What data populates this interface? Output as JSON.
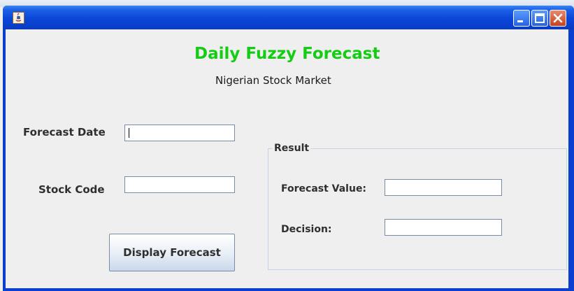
{
  "window": {
    "title": "",
    "icon": "java-app-icon",
    "controls": [
      "minimize-icon",
      "maximize-icon",
      "close-icon"
    ]
  },
  "header": {
    "title": "Daily Fuzzy Forecast",
    "subtitle": "Nigerian Stock Market"
  },
  "form": {
    "forecast_date_label": "Forecast Date",
    "forecast_date_value": "",
    "stock_code_label": "Stock Code",
    "stock_code_value": "",
    "display_button_label": "Display Forecast"
  },
  "result": {
    "group_title": "Result",
    "forecast_value_label": "Forecast Value:",
    "forecast_value_value": "",
    "decision_label": "Decision:",
    "decision_value": ""
  },
  "colors": {
    "title_green": "#13cc13",
    "titlebar_blue": "#0a3fcf",
    "background": "#efefef"
  }
}
